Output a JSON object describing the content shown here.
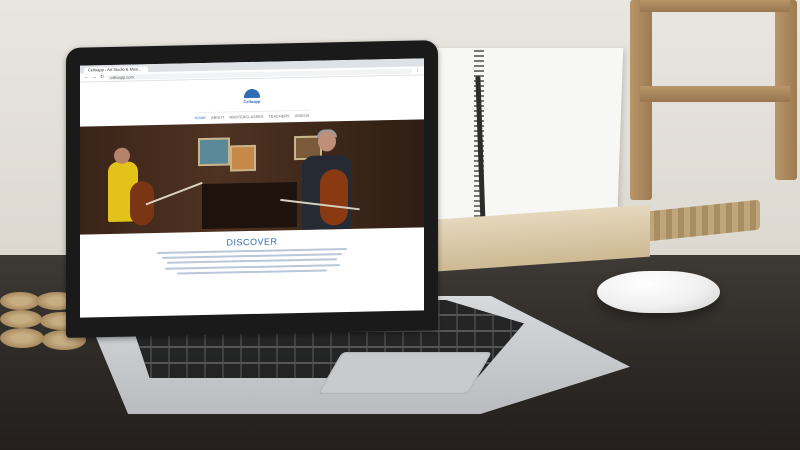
{
  "browser": {
    "tab_label": "Celloapp - Art Studio & Musi...",
    "url": "celloapp.com",
    "back_icon": "arrow-left-icon",
    "forward_icon": "arrow-right-icon",
    "reload_icon": "reload-icon"
  },
  "site": {
    "logo_text": "Celloapp",
    "nav": [
      "HOME",
      "ABOUT",
      "MASTERCLASSES",
      "TEACHERS",
      "VIDEOS"
    ],
    "active_nav": "HOME",
    "section_heading": "DISCOVER",
    "accent": "#2e6db4"
  }
}
